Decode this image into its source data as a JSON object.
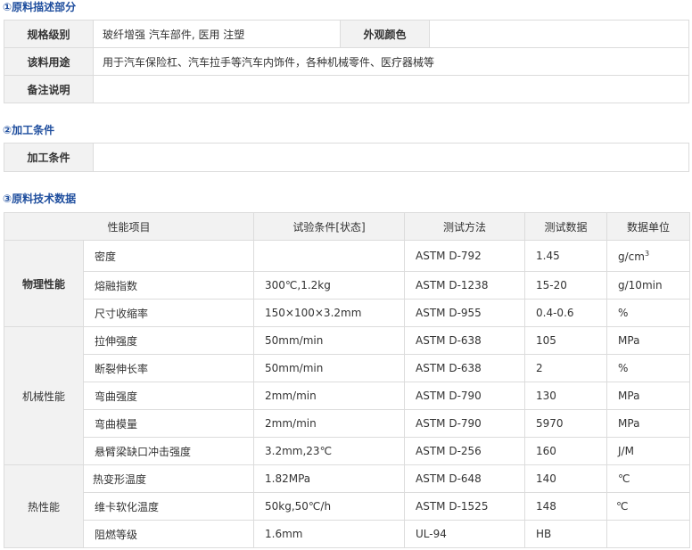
{
  "section1": {
    "title": "①原料描述部分",
    "rows": {
      "grade_label": "规格级别",
      "grade_value": "玻纤增强 汽车部件, 医用 注塑",
      "color_label": "外观颜色",
      "color_value": "",
      "usage_label": "该料用途",
      "usage_value": "用于汽车保险杠、汽车拉手等汽车内饰件，各种机械零件、医疗器械等",
      "notes_label": "备注说明",
      "notes_value": ""
    }
  },
  "section2": {
    "title": "②加工条件",
    "label": "加工条件",
    "value": ""
  },
  "section3": {
    "title": "③原料技术数据",
    "headers": [
      "性能项目",
      "试验条件[状态]",
      "测试方法",
      "测试数据",
      "数据单位"
    ],
    "groups": [
      {
        "name": "物理性能",
        "rows": [
          {
            "item": "密度",
            "condition": "",
            "method": "ASTM D-792",
            "value": "1.45",
            "unit": "g/cm",
            "unit_sup": "3"
          },
          {
            "item": "熔融指数",
            "condition": "300℃,1.2kg",
            "method": "ASTM D-1238",
            "value": "15-20",
            "unit": "g/10min"
          },
          {
            "item": "尺寸收缩率",
            "condition": "150×100×3.2mm",
            "method": "ASTM D-955",
            "value": "0.4-0.6",
            "unit": "%"
          }
        ]
      },
      {
        "name": "机械性能",
        "rows": [
          {
            "item": "拉伸强度",
            "condition": "50mm/min",
            "method": "ASTM D-638",
            "value": "105",
            "unit": "MPa"
          },
          {
            "item": "断裂伸长率",
            "condition": "50mm/min",
            "method": "ASTM D-638",
            "value": "2",
            "unit": "%"
          },
          {
            "item": "弯曲强度",
            "condition": "2mm/min",
            "method": "ASTM D-790",
            "value": "130",
            "unit": "MPa"
          },
          {
            "item": "弯曲模量",
            "condition": "2mm/min",
            "method": "ASTM D-790",
            "value": "5970",
            "unit": "MPa"
          },
          {
            "item": "悬臂梁缺口冲击强度",
            "condition": "3.2mm,23℃",
            "method": "ASTM D-256",
            "value": "160",
            "unit": "J/M"
          }
        ]
      },
      {
        "name": "热性能",
        "rows": [
          {
            "item": "热变形温度",
            "condition": "1.82MPa",
            "method": "ASTM D-648",
            "value": "140",
            "unit": "℃"
          },
          {
            "item": "维卡软化温度",
            "condition": "50kg,50℃/h",
            "method": "ASTM D-1525",
            "value": "148",
            "unit": "℃"
          },
          {
            "item": "阻燃等级",
            "condition": "1.6mm",
            "method": "UL-94",
            "value": "HB",
            "unit": ""
          }
        ]
      }
    ]
  }
}
